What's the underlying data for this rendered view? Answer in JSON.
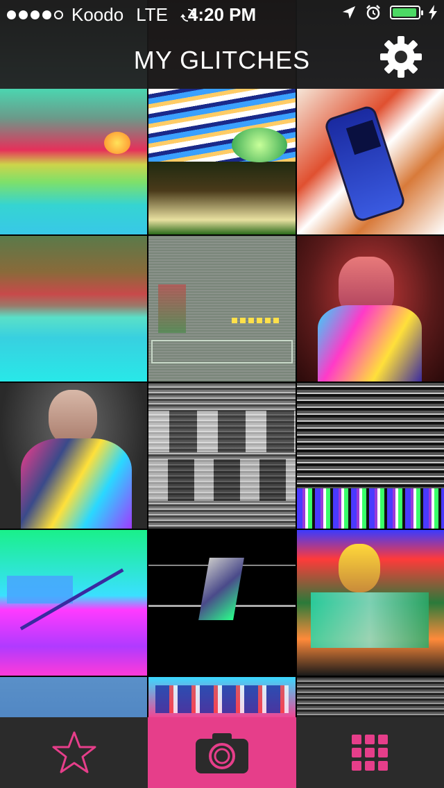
{
  "status_bar": {
    "signal_dots_filled": 4,
    "signal_dots_total": 5,
    "carrier": "Koodo",
    "network": "LTE",
    "time": "4:20 PM",
    "battery_level": 0.95
  },
  "nav": {
    "title": "MY GLITCHES",
    "settings_icon": "gear-icon"
  },
  "gallery": {
    "tiles": [
      {
        "name": "glitch-sunset-ocean"
      },
      {
        "name": "glitch-storm-clouds"
      },
      {
        "name": "glitch-cellphone"
      },
      {
        "name": "glitch-ocean-horizon"
      },
      {
        "name": "glitch-pixel-game"
      },
      {
        "name": "glitch-jessica-judge-red"
      },
      {
        "name": "glitch-jessica-judge"
      },
      {
        "name": "glitch-grey-repeat"
      },
      {
        "name": "glitch-noise-bars"
      },
      {
        "name": "glitch-neon-pen"
      },
      {
        "name": "glitch-dark-shape"
      },
      {
        "name": "glitch-dj"
      },
      {
        "name": "glitch-blue-partial"
      },
      {
        "name": "glitch-omega-text"
      },
      {
        "name": "glitch-noise-partial"
      }
    ]
  },
  "tabbar": {
    "tabs": [
      {
        "name": "favorites",
        "icon": "star-icon",
        "active": false
      },
      {
        "name": "camera",
        "icon": "camera-icon",
        "active": true
      },
      {
        "name": "gallery",
        "icon": "grid-icon",
        "active": false
      }
    ]
  },
  "colors": {
    "accent": "#e63e8a",
    "tabbar_bg": "#2b2b2b",
    "battery": "#4cd964"
  }
}
